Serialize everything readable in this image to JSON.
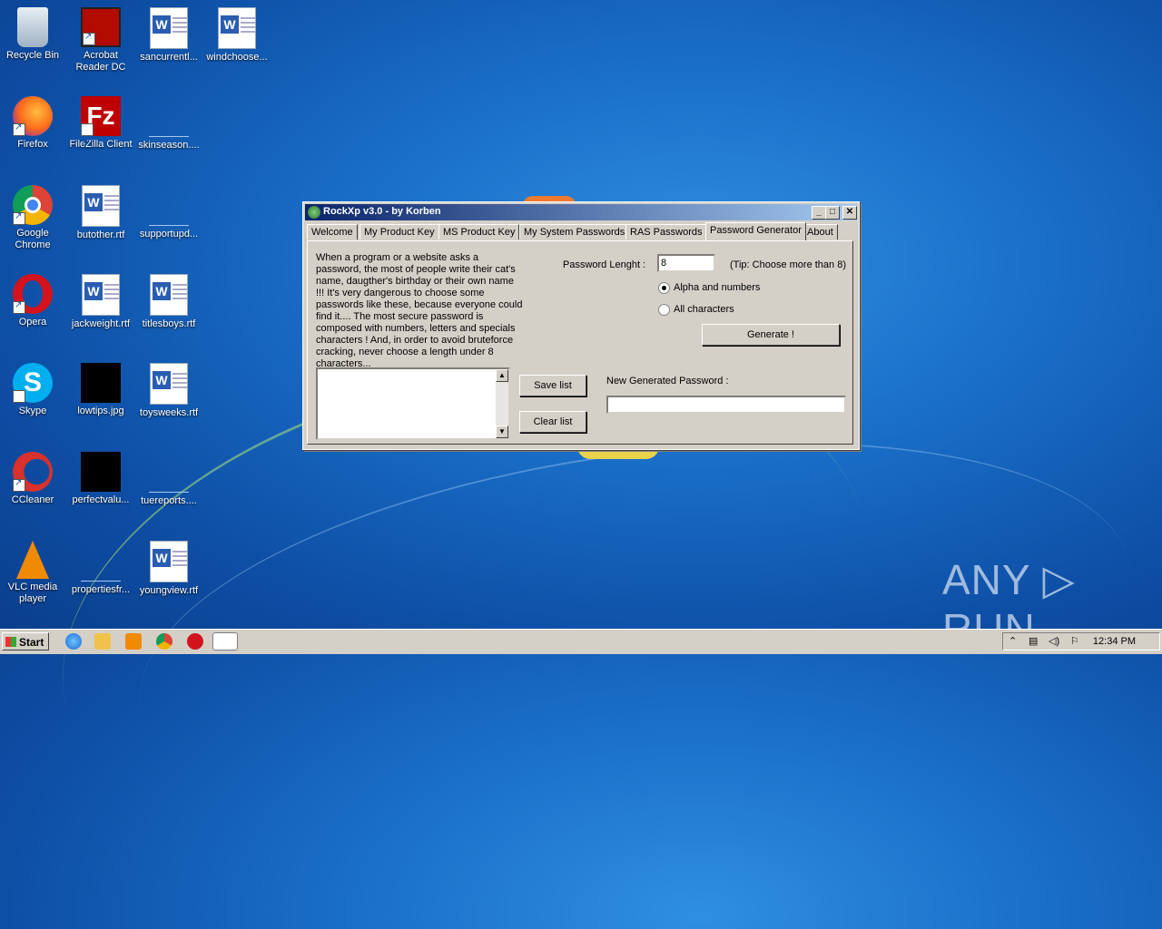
{
  "desktop": {
    "icons": [
      {
        "label": "Recycle Bin"
      },
      {
        "label": "Acrobat Reader DC"
      },
      {
        "label": "sancurrentl..."
      },
      {
        "label": "windchoose..."
      },
      {
        "label": "Firefox"
      },
      {
        "label": "FileZilla Client"
      },
      {
        "label": "skinseason...."
      },
      {
        "label": "Google Chrome"
      },
      {
        "label": "butother.rtf"
      },
      {
        "label": "supportupd..."
      },
      {
        "label": "Opera"
      },
      {
        "label": "jackweight.rtf"
      },
      {
        "label": "titlesboys.rtf"
      },
      {
        "label": "Skype"
      },
      {
        "label": "lowtips.jpg"
      },
      {
        "label": "toysweeks.rtf"
      },
      {
        "label": "CCleaner"
      },
      {
        "label": "perfectvalu..."
      },
      {
        "label": "tuereports...."
      },
      {
        "label": "VLC media player"
      },
      {
        "label": "propertiesfr..."
      },
      {
        "label": "youngview.rtf"
      }
    ]
  },
  "window": {
    "title": "RockXp v3.0 - by Korben",
    "controls": {
      "minimize": "_",
      "maximize": "□",
      "close": "✕"
    },
    "tabs": [
      "Welcome",
      "My Product Key",
      "MS Product Key",
      "My System Passwords",
      "RAS Passwords",
      "Password Generator",
      "About"
    ],
    "active_tab": "Password Generator",
    "description": "When a program or a website asks a password, the most of people write their cat's name, daugther's birthday or their own name !!! It's very dangerous to choose some passwords like these, because everyone could find it.... The most secure password is composed with numbers, letters and specials characters ! And, in order to avoid bruteforce cracking, never choose a length under 8 characters...",
    "password_length_label": "Password Lenght :",
    "password_length_value": "8",
    "tip": "(Tip: Choose more than 8)",
    "radio_alpha": "Alpha and numbers",
    "radio_all": "All characters",
    "generate_label": "Generate !",
    "save_label": "Save list",
    "clear_label": "Clear list",
    "new_password_label": "New Generated Password :",
    "new_password_value": ""
  },
  "taskbar": {
    "start_label": "Start",
    "clock": "12:34 PM"
  },
  "watermark": "ANY ▷ RUN"
}
